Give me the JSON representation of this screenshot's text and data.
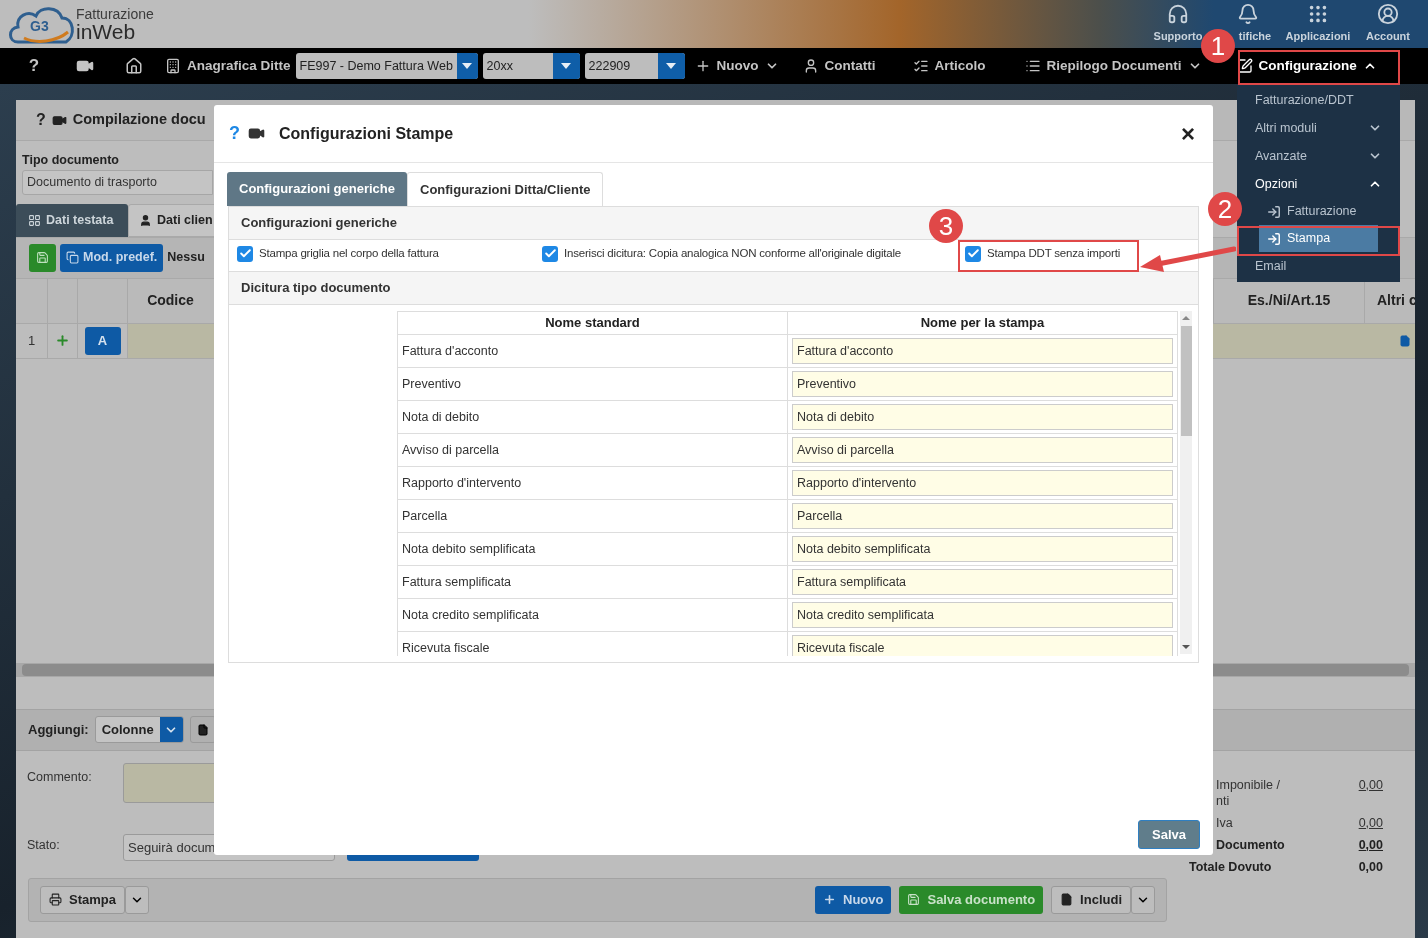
{
  "header": {
    "logo_mark": "G3",
    "logo_line1": "Fatturazione",
    "logo_line2": "inWeb",
    "actions": [
      {
        "label": "Supporto"
      },
      {
        "label": "tifiche"
      },
      {
        "label": "Applicazioni"
      },
      {
        "label": "Account"
      }
    ]
  },
  "navbar": {
    "help": "?",
    "company_label": "Anagrafica Ditte",
    "selects": [
      {
        "value": "FE997 - Demo Fattura Web"
      },
      {
        "value": "20xx"
      },
      {
        "value": "222909"
      }
    ],
    "links": [
      {
        "label": "Nuovo",
        "kind": "dropdown",
        "expanded": false,
        "selected": false
      },
      {
        "label": "Contatti",
        "kind": "link",
        "selected": false
      },
      {
        "label": "Articolo",
        "kind": "link",
        "selected": false
      },
      {
        "label": "Riepilogo Documenti",
        "kind": "dropdown",
        "expanded": false,
        "selected": false
      },
      {
        "label": "Configurazione",
        "kind": "dropdown",
        "expanded": true,
        "selected": true
      }
    ]
  },
  "menu": {
    "items": [
      {
        "label": "Fatturazione/DDT",
        "kind": "item",
        "selected": false
      },
      {
        "label": "Altri moduli",
        "kind": "group",
        "expanded": false,
        "selected": false
      },
      {
        "label": "Avanzate",
        "kind": "group",
        "expanded": false,
        "selected": false
      },
      {
        "label": "Opzioni",
        "kind": "group",
        "expanded": true,
        "selected": false
      },
      {
        "label": "Fatturazione",
        "kind": "sub",
        "selected": false
      },
      {
        "label": "Stampa",
        "kind": "sub",
        "selected": true
      },
      {
        "label": "Email",
        "kind": "item",
        "selected": false
      }
    ]
  },
  "page": {
    "help": "?",
    "title": "Compilazione docu",
    "doc_type": {
      "label": "Tipo documento",
      "value": "Documento di trasporto"
    },
    "tabs": [
      {
        "label": "Dati testata",
        "selected": true
      },
      {
        "label": "Dati clien",
        "selected": false
      }
    ],
    "template_button": "Mod. predef.",
    "template_text": "Nessu",
    "columns": [
      "Codice",
      "Es./Ni/Art.15",
      "Altri c"
    ],
    "row": {
      "index": "1",
      "button": "A"
    },
    "add": {
      "label": "Aggiungi:",
      "value": "Colonne"
    },
    "comment_label": "Commento:",
    "status": {
      "label": "Stato:",
      "value": "Seguirà docum"
    },
    "totals": [
      {
        "label": "Imponibile /",
        "label_2": "nti",
        "value": "0,00",
        "bold": false,
        "link": true
      },
      {
        "label": "Iva",
        "value": "0,00",
        "bold": false,
        "link": true
      },
      {
        "label": "Documento",
        "value": "0,00",
        "bold": true,
        "link": true
      },
      {
        "label": "Totale Dovuto",
        "value": "0,00",
        "bold": true,
        "link": false
      }
    ],
    "actions": [
      {
        "label": "Stampa",
        "kind": "split"
      },
      {
        "label": "Nuovo",
        "kind": "primary"
      },
      {
        "label": "Salva documento",
        "kind": "success"
      },
      {
        "label": "Includi",
        "kind": "split"
      }
    ]
  },
  "modal": {
    "help": "?",
    "title": "Configurazioni Stampe",
    "close": "×",
    "tabs": [
      {
        "label": "Configurazioni generiche",
        "selected": true
      },
      {
        "label": "Configurazioni Ditta/Cliente",
        "selected": false
      }
    ],
    "section_title": "Configurazioni generiche",
    "options": [
      {
        "label": "Stampa griglia nel corpo della fattura",
        "checked": true
      },
      {
        "label": "Inserisci dicitura: Copia analogica NON conforme all'originale digitale",
        "checked": true
      },
      {
        "label": "Stampa DDT senza importi",
        "checked": true
      }
    ],
    "table_title": "Dicitura tipo documento",
    "columns": [
      "Nome standard",
      "Nome per la stampa"
    ],
    "rows": [
      {
        "standard": "Fattura d'acconto",
        "print_name": "Fattura d'acconto"
      },
      {
        "standard": "Preventivo",
        "print_name": "Preventivo"
      },
      {
        "standard": "Nota di debito",
        "print_name": "Nota di debito"
      },
      {
        "standard": "Avviso di parcella",
        "print_name": "Avviso di parcella"
      },
      {
        "standard": "Rapporto d'intervento",
        "print_name": "Rapporto d'intervento"
      },
      {
        "standard": "Parcella",
        "print_name": "Parcella"
      },
      {
        "standard": "Nota debito semplificata",
        "print_name": "Nota debito semplificata"
      },
      {
        "standard": "Fattura semplificata",
        "print_name": "Fattura semplificata"
      },
      {
        "standard": "Nota credito semplificata",
        "print_name": "Nota credito semplificata"
      },
      {
        "standard": "Ricevuta fiscale",
        "print_name": "Ricevuta fiscale"
      }
    ],
    "save": "Salva"
  },
  "annotations": [
    {
      "label": "1"
    },
    {
      "label": "2"
    },
    {
      "label": "3"
    }
  ]
}
